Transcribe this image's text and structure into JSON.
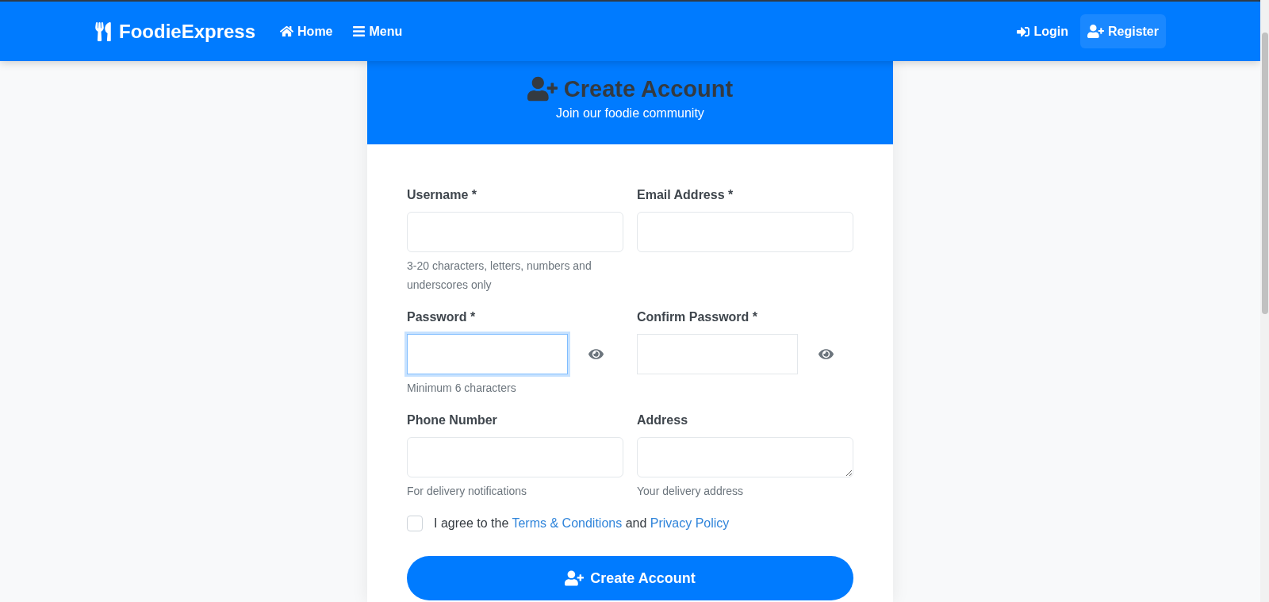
{
  "navbar": {
    "brand": "FoodieExpress",
    "links": [
      {
        "label": "Home"
      },
      {
        "label": "Menu"
      }
    ],
    "auth_links": [
      {
        "label": "Login",
        "selected": false
      },
      {
        "label": "Register",
        "selected": true
      }
    ]
  },
  "card": {
    "title": "Create Account",
    "subtitle": "Join our foodie community"
  },
  "fields": [
    {
      "kind": "text",
      "label": "Username *",
      "help": "3-20 characters, letters, numbers and underscores only",
      "focused": false
    },
    {
      "kind": "text",
      "label": "Email Address *",
      "focused": false
    },
    {
      "kind": "password",
      "label": "Password *",
      "help": "Minimum 6 characters",
      "focused": true
    },
    {
      "kind": "password",
      "label": "Confirm Password *",
      "focused": false
    },
    {
      "kind": "text",
      "label": "Phone Number",
      "help": "For delivery notifications",
      "focused": false
    },
    {
      "kind": "textarea",
      "label": "Address",
      "help": "Your delivery address",
      "focused": false
    }
  ],
  "agreement": {
    "checked": false,
    "parts": [
      {
        "kind": "text",
        "text": "I agree to the"
      },
      {
        "kind": "link",
        "text": "Terms & Conditions"
      },
      {
        "kind": "text",
        "text": "and"
      },
      {
        "kind": "link",
        "text": "Privacy Policy"
      }
    ]
  },
  "submit_button": {
    "label": "Create Account"
  }
}
